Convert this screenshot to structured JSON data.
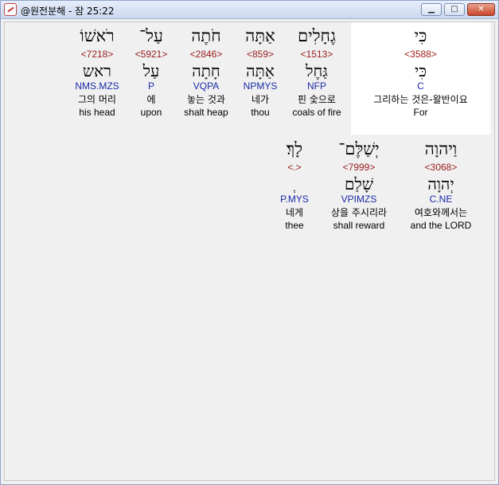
{
  "window": {
    "title": "@원전분해 - 잠 25:22",
    "minimize_label": "▁",
    "maximize_label": "□",
    "close_label": "✕"
  },
  "rows": [
    {
      "words": [
        {
          "hebrew": "כִּי",
          "strong": "<3588>",
          "lemma": "כִּי",
          "parse": "C",
          "korean": "그리하는 것은-왈반이요",
          "english": "For",
          "selected": true
        },
        {
          "hebrew": "גֶחָלִים",
          "strong": "<1513>",
          "lemma": "גַּחֶל",
          "parse": "NFP",
          "korean": "핀 숯으로",
          "english": "coals of fire"
        },
        {
          "hebrew": "אַתָּה",
          "strong": "<859>",
          "lemma": "אַתָּה",
          "parse": "NPMYS",
          "korean": "네가",
          "english": "thou"
        },
        {
          "hebrew": "חֹתֶה",
          "strong": "<2846>",
          "lemma": "חָתָה",
          "parse": "VQPA",
          "korean": "놓는 것과",
          "english": "shalt heap"
        },
        {
          "hebrew": "עַל־",
          "strong": "<5921>",
          "lemma": "עַל",
          "parse": "P",
          "korean": "에",
          "english": "upon"
        },
        {
          "hebrew": "רֹאשׁוֹ",
          "strong": "<7218>",
          "lemma": "ראש",
          "parse": "NMS.MZS",
          "korean": "그의 머리",
          "english": "his head"
        }
      ]
    },
    {
      "words": [
        {
          "hebrew": "וַיהוָה",
          "strong": "<3068>",
          "lemma": "יְהוָה",
          "parse": "C.NE",
          "korean": "여호와께서는",
          "english": "and the LORD"
        },
        {
          "hebrew": "יְשַׁלֶּם־",
          "strong": "<7999>",
          "lemma": "שָׁלַם",
          "parse": "VPIMZS",
          "korean": "상을 주시리라",
          "english": "shall reward"
        },
        {
          "hebrew": "לָךְ׃",
          "strong": "<.>",
          "lemma": "ְ",
          "parse": "P.MYS",
          "korean": "네게",
          "english": "thee"
        }
      ]
    }
  ]
}
